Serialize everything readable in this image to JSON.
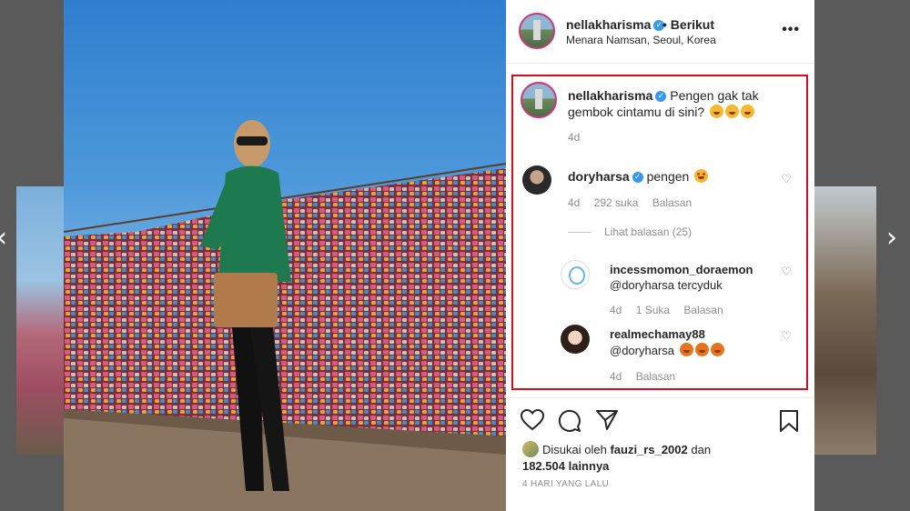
{
  "navigation": {
    "prev_icon": "‹",
    "next_icon": "›"
  },
  "post": {
    "username": "nellakharisma",
    "verified_icon": "✓",
    "follow_text": "• Berikut",
    "location": "Menara Namsan, Seoul, Korea",
    "more_icon": "•••"
  },
  "caption": {
    "username": "nellakharisma",
    "text": "Pengen gak tak gembok cintamu di sini?",
    "emoji_count": 3,
    "time": "4d"
  },
  "comments": [
    {
      "username": "doryharsa",
      "verified": true,
      "text": "pengen",
      "time": "4d",
      "likes": "292 suka",
      "reply": "Balasan"
    },
    {
      "username": "incessmomon_doraemon",
      "text": "@doryharsa tercyduk",
      "time": "4d",
      "likes": "1 Suka",
      "reply": "Balasan"
    },
    {
      "username": "realmechamay88",
      "text": "@doryharsa",
      "time": "4d",
      "reply": "Balasan"
    }
  ],
  "view_replies": "Lihat balasan (25)",
  "likes": {
    "prefix": "Disukai oleh",
    "user": "fauzi_rs_2002",
    "connector": "dan",
    "count": "182.504 lainnya"
  },
  "date": "4 HARI YANG LALU",
  "colors": {
    "highlight_border": "#d10f1b",
    "verified": "#3897f0",
    "muted": "#8e8e8e"
  }
}
